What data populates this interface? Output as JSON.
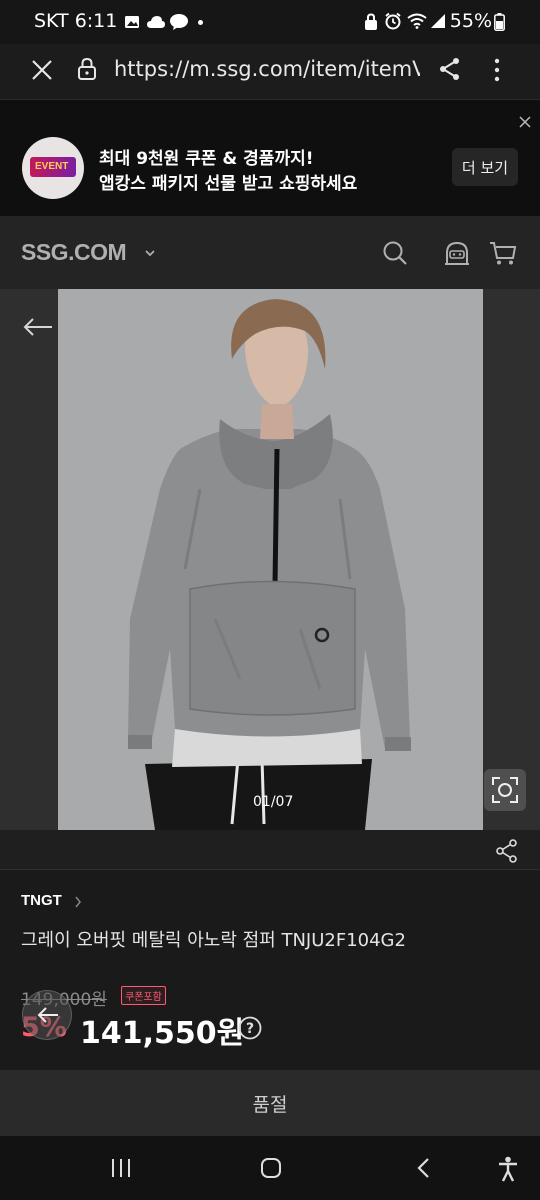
{
  "status_bar": {
    "carrier_time": "SKT 6:11",
    "battery": "55%"
  },
  "browser": {
    "url": "https://m.ssg.com/item/itemView"
  },
  "banner": {
    "badge_text": "EVENT",
    "line1": "최대 9천원 쿠폰 & 경품까지!",
    "line2": "앱캉스 패키지 선물 받고 쇼핑하세요",
    "more_label": "더 보기"
  },
  "header": {
    "logo": "SSG.COM"
  },
  "gallery": {
    "counter": "01/07"
  },
  "product": {
    "brand": "TNGT",
    "name": "그레이 오버핏 메탈릭 아노락 점퍼 TNJU2F104G2",
    "original_price": "149,000원",
    "coupon_tag": "쿠폰포함",
    "discount": "5%",
    "sale_price": "141,550원"
  },
  "bottom_bar": {
    "label": "품절"
  },
  "colors": {
    "accent": "#ff5a6e",
    "background": "#1a1a1a"
  }
}
